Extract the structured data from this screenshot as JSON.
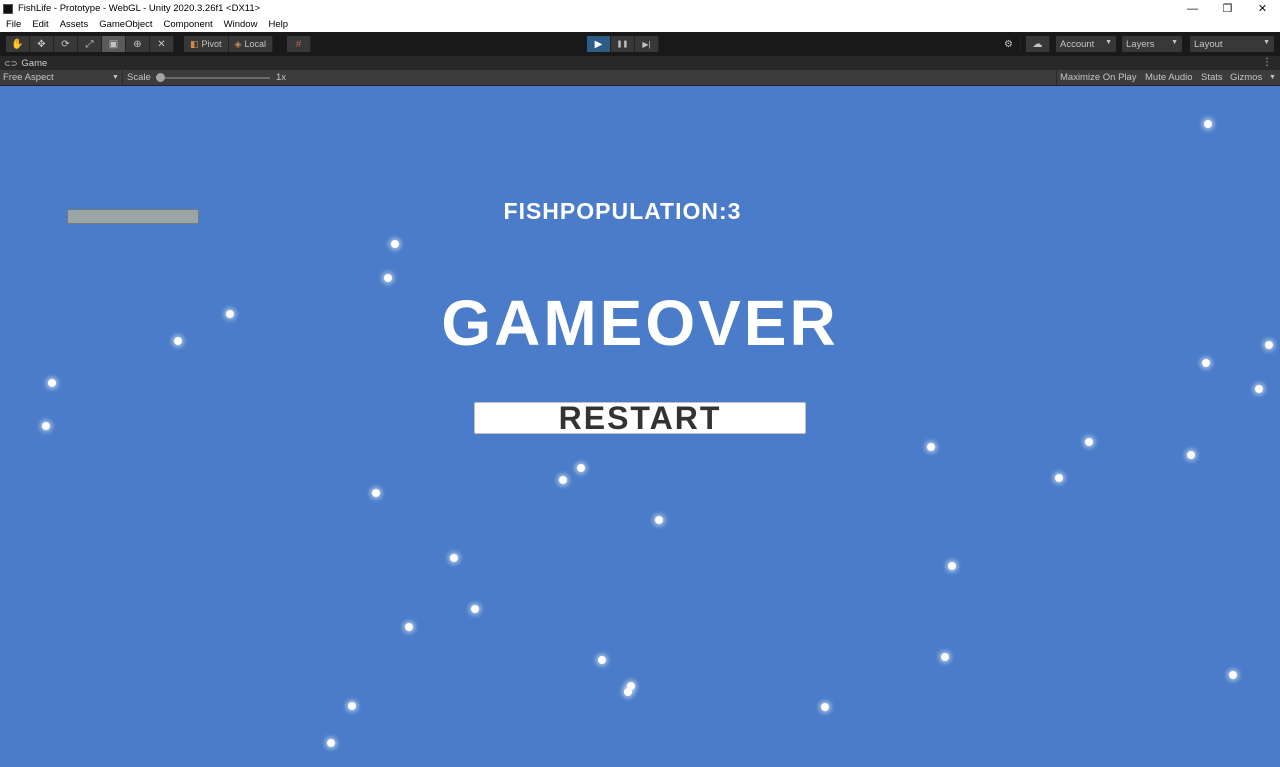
{
  "window": {
    "title": "FishLife - Prototype - WebGL - Unity 2020.3.26f1 <DX11>",
    "controls": {
      "minimize": "—",
      "restore": "❐",
      "close": "✕"
    }
  },
  "menu": [
    "File",
    "Edit",
    "Assets",
    "GameObject",
    "Component",
    "Window",
    "Help"
  ],
  "toolbar": {
    "tools": [
      {
        "name": "hand-tool",
        "glyph": "✋"
      },
      {
        "name": "move-tool",
        "glyph": "✥"
      },
      {
        "name": "rotate-tool",
        "glyph": "⟳"
      },
      {
        "name": "scale-tool",
        "glyph": "⤢"
      },
      {
        "name": "rect-tool",
        "glyph": "▣"
      },
      {
        "name": "transform-tool",
        "glyph": "⊕"
      },
      {
        "name": "custom-tool",
        "glyph": "✕"
      }
    ],
    "pivot_label": "Pivot",
    "local_label": "Local",
    "grid_glyph": "#",
    "play_glyph": "▶",
    "pause_glyph": "❚❚",
    "step_glyph": "▶|",
    "account_label": "Account",
    "layers_label": "Layers",
    "layout_label": "Layout"
  },
  "tab": {
    "label": "Game",
    "menu_glyph": "⋮"
  },
  "gamebar": {
    "aspect": "Free Aspect",
    "scale_label": "Scale",
    "scale_value": "1x",
    "maximize": "Maximize On Play",
    "mute": "Mute Audio",
    "stats": "Stats",
    "gizmos": "Gizmos"
  },
  "game": {
    "population_text": "FISHPOPULATION:3",
    "gameover_text": "GAMEOVER",
    "restart_label": "RESTART",
    "health_fill": 1.0
  },
  "colors": {
    "game_background": "#4a7cc9",
    "toolbar": "#191919",
    "play_active": "#2c5d87"
  }
}
